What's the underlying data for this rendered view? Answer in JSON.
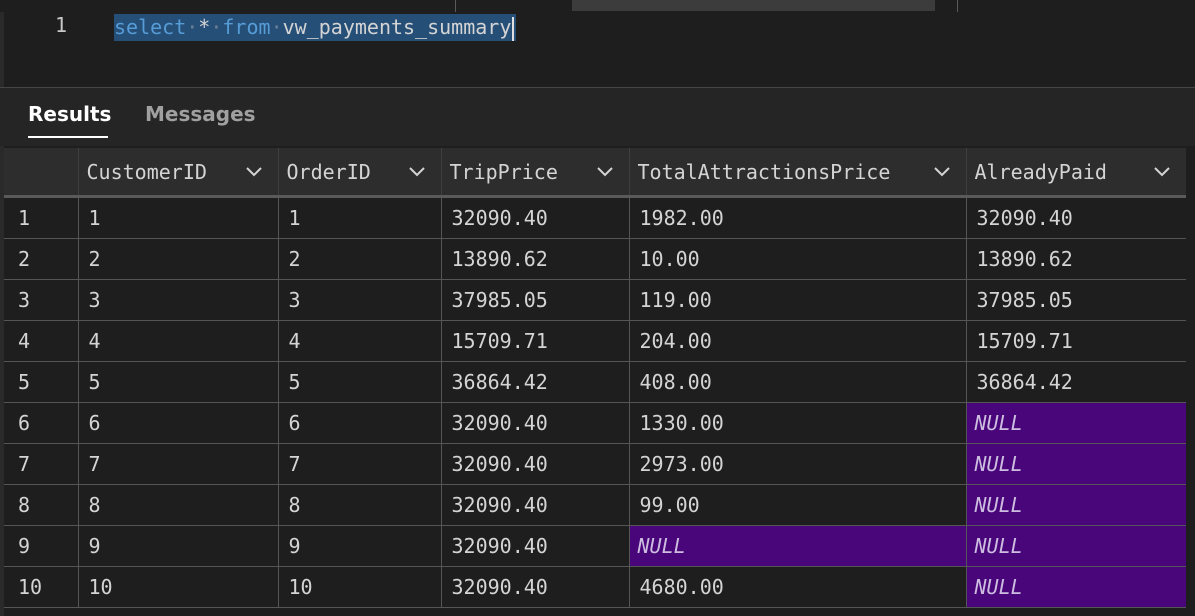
{
  "editor": {
    "line_number": "1",
    "tokens": {
      "select": "select",
      "star": "*",
      "from": "from",
      "object": "vw_payments_summary"
    }
  },
  "tabs": [
    {
      "label": "Results",
      "active": true
    },
    {
      "label": "Messages",
      "active": false
    }
  ],
  "grid": {
    "columns": [
      "CustomerID",
      "OrderID",
      "TripPrice",
      "TotalAttractionsPrice",
      "AlreadyPaid"
    ],
    "rows": [
      {
        "n": "1",
        "cells": [
          "1",
          "1",
          "32090.40",
          "1982.00",
          "32090.40"
        ]
      },
      {
        "n": "2",
        "cells": [
          "2",
          "2",
          "13890.62",
          "10.00",
          "13890.62"
        ]
      },
      {
        "n": "3",
        "cells": [
          "3",
          "3",
          "37985.05",
          "119.00",
          "37985.05"
        ]
      },
      {
        "n": "4",
        "cells": [
          "4",
          "4",
          "15709.71",
          "204.00",
          "15709.71"
        ]
      },
      {
        "n": "5",
        "cells": [
          "5",
          "5",
          "36864.42",
          "408.00",
          "36864.42"
        ]
      },
      {
        "n": "6",
        "cells": [
          "6",
          "6",
          "32090.40",
          "1330.00",
          "NULL"
        ]
      },
      {
        "n": "7",
        "cells": [
          "7",
          "7",
          "32090.40",
          "2973.00",
          "NULL"
        ]
      },
      {
        "n": "8",
        "cells": [
          "8",
          "8",
          "32090.40",
          "99.00",
          "NULL"
        ]
      },
      {
        "n": "9",
        "cells": [
          "9",
          "9",
          "32090.40",
          "NULL",
          "NULL"
        ]
      },
      {
        "n": "10",
        "cells": [
          "10",
          "10",
          "32090.40",
          "4680.00",
          "NULL"
        ]
      }
    ]
  },
  "colors": {
    "null_cell_bg": "#48067a",
    "selection_bg": "#264f78",
    "keyword": "#569cd6"
  }
}
